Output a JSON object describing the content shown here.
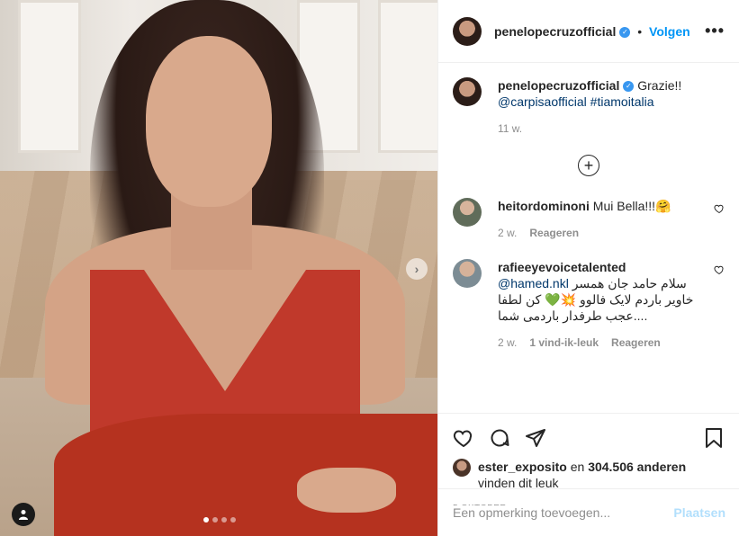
{
  "post": {
    "username": "penelopecruzofficial",
    "follow_label": "Volgen",
    "more_label": "•••",
    "carousel": {
      "dot_count": 4,
      "active_index": 0
    }
  },
  "caption": {
    "username": "penelopecruzofficial",
    "text": "Grazie!!",
    "mention": "@carpisaofficial",
    "hashtag": "#tiamoitalia",
    "time": "11 w."
  },
  "comments": [
    {
      "username": "heitordominoni",
      "text": "Mui Bella!!!🤗",
      "time": "2 w.",
      "reply_label": "Reageren"
    },
    {
      "username": "rafieeyevoicetalented",
      "mention": "@hamed.nkl",
      "text_line1": "سلام حامد جان همسر",
      "text_line2": "خاویر باردم لایک فالوو 💥💚 کن لطفا",
      "text_line3": "عجب طرفدار باردمی شما....",
      "time": "2 w.",
      "likes_label": "1 vind-ik-leuk",
      "reply_label": "Reageren"
    }
  ],
  "likes": {
    "user": "ester_exposito",
    "joiner": "en",
    "count": "304.506 anderen",
    "suffix": "vinden dit leuk"
  },
  "date": "5 OKTOBER",
  "add_comment": {
    "placeholder": "Een opmerking toevoegen...",
    "post_label": "Plaatsen"
  },
  "colors": {
    "link_blue": "#0095f6",
    "mention": "#00376b",
    "muted": "#8e8e8e",
    "post_disabled": "#b2dffc"
  }
}
